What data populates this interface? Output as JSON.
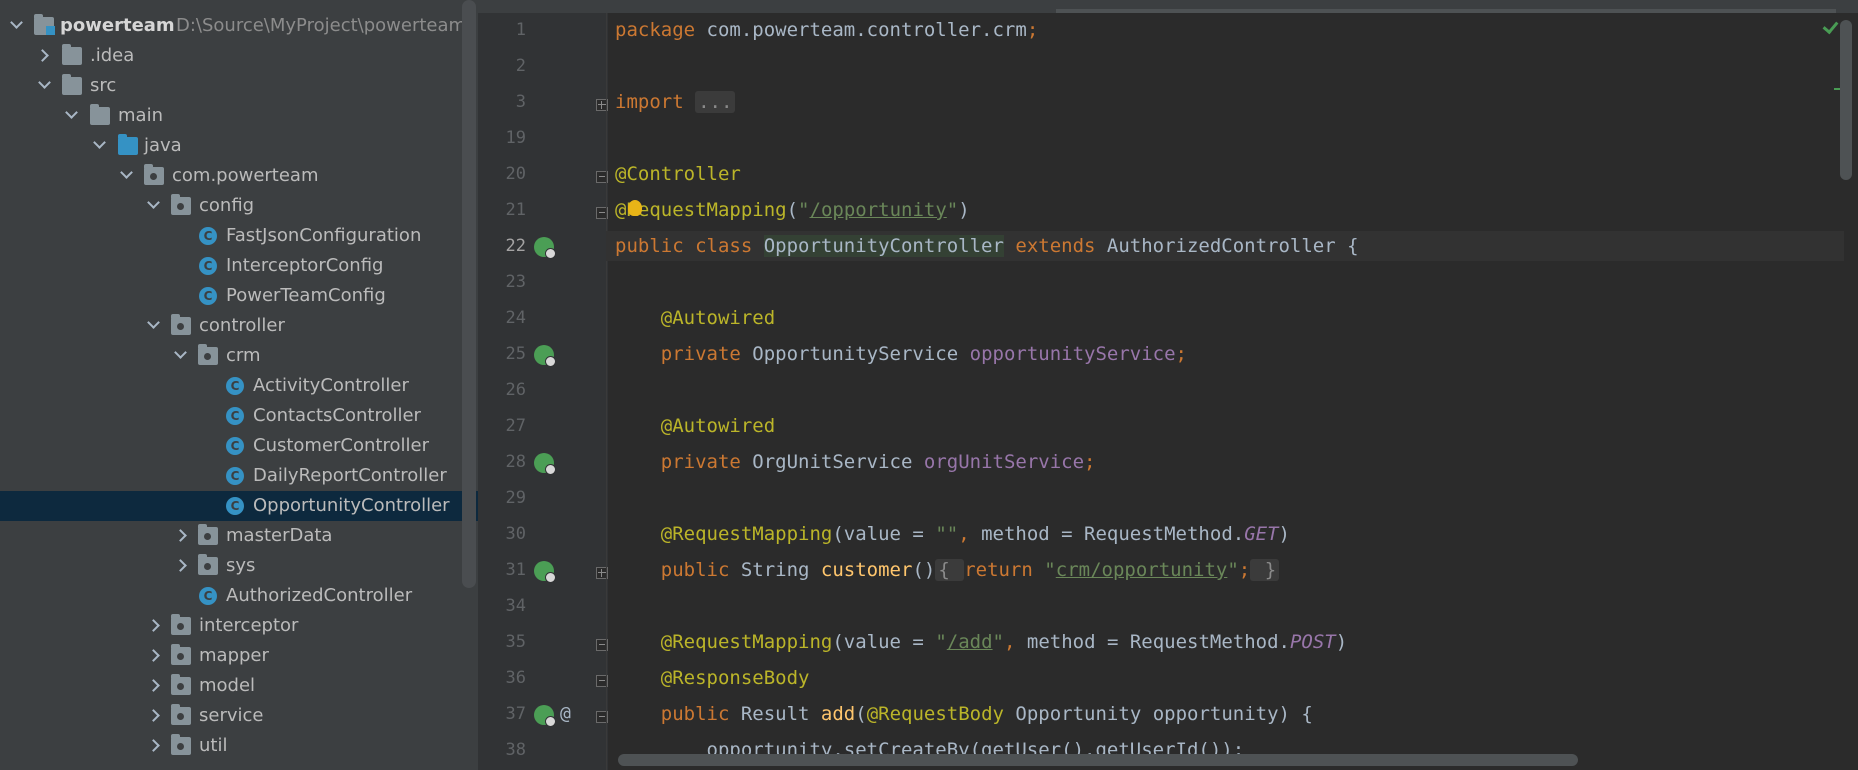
{
  "project_tree": {
    "root": {
      "label": "powerteam",
      "path": "D:\\Source\\MyProject\\powerteam"
    },
    "items": [
      {
        "label": "powerteam",
        "path": "D:\\Source\\MyProject\\powerteam"
      },
      {
        "label": ".idea"
      },
      {
        "label": "src"
      },
      {
        "label": "main"
      },
      {
        "label": "java"
      },
      {
        "label": "com.powerteam"
      },
      {
        "label": "config"
      },
      {
        "label": "FastJsonConfiguration"
      },
      {
        "label": "InterceptorConfig"
      },
      {
        "label": "PowerTeamConfig"
      },
      {
        "label": "controller"
      },
      {
        "label": "crm"
      },
      {
        "label": "ActivityController"
      },
      {
        "label": "ContactsController"
      },
      {
        "label": "CustomerController"
      },
      {
        "label": "DailyReportController"
      },
      {
        "label": "OpportunityController"
      },
      {
        "label": "masterData"
      },
      {
        "label": "sys"
      },
      {
        "label": "AuthorizedController"
      },
      {
        "label": "interceptor"
      },
      {
        "label": "mapper"
      },
      {
        "label": "model"
      },
      {
        "label": "service"
      },
      {
        "label": "util"
      }
    ],
    "selected": "OpportunityController"
  },
  "editor": {
    "line_numbers": [
      "1",
      "2",
      "3",
      "19",
      "20",
      "21",
      "22",
      "23",
      "24",
      "25",
      "26",
      "27",
      "28",
      "29",
      "30",
      "31",
      "34",
      "35",
      "36",
      "37",
      "38"
    ],
    "current_line": "22",
    "gutter_at": "@",
    "lines": {
      "l1": {
        "kw": "package",
        "rest": " com.powerteam.controller.crm",
        "semi": ";"
      },
      "l3": {
        "kw": "import",
        "fold": "..."
      },
      "l20": {
        "ann": "@Controller"
      },
      "l21": {
        "ann": "@RequestMapping",
        "open": "(",
        "q1": "\"",
        "str": "/opportunity",
        "q2": "\"",
        "close": ")"
      },
      "l22": {
        "kw1": "public class ",
        "cls": "OpportunityController",
        "kw2": " extends ",
        "base": "AuthorizedController {"
      },
      "l24": {
        "ann": "@Autowired"
      },
      "l25": {
        "kw": "private ",
        "type": "OpportunityService ",
        "field": "opportunityService",
        "semi": ";"
      },
      "l27": {
        "ann": "@Autowired"
      },
      "l28": {
        "kw": "private ",
        "type": "OrgUnitService ",
        "field": "orgUnitService",
        "semi": ";"
      },
      "l30": {
        "ann": "@RequestMapping",
        "a": "(value = ",
        "str": "\"\"",
        "comma": ",",
        "b": " method = RequestMethod.",
        "const": "GET",
        "c": ")"
      },
      "l31": {
        "kw": "public ",
        "type": "String ",
        "fn": "customer",
        "parens": "()",
        "ob": "{ ",
        "ret": "return ",
        "q1": "\"",
        "str": "crm/opportunity",
        "q2": "\"",
        "semi": ";",
        "cb": " }"
      },
      "l35": {
        "ann": "@RequestMapping",
        "a": "(value = ",
        "q1": "\"",
        "str": "/add",
        "q2": "\"",
        "comma": ",",
        "b": " method = RequestMethod.",
        "const": "POST",
        "c": ")"
      },
      "l36": {
        "ann": "@ResponseBody"
      },
      "l37": {
        "kw": "public ",
        "type": "Result ",
        "fn": "add",
        "open": "(",
        "ann": "@RequestBody",
        "rest": " Opportunity opportunity) {"
      },
      "l38": {
        "text": "opportunity.setCreateBy(getUser().getUserId());"
      }
    }
  },
  "colors": {
    "keyword": "#cc7832",
    "annotation": "#bbb529",
    "string": "#6a8759",
    "method": "#ffc66d",
    "field": "#9876aa",
    "text": "#a9b7c6",
    "selection": "#0d293e"
  },
  "icons": [
    "chevron-right-icon",
    "chevron-down-icon",
    "folder-icon",
    "module-icon",
    "package-icon",
    "class-icon",
    "spring-bean-gutter-icon",
    "inspection-ok-icon",
    "lightbulb-icon"
  ]
}
